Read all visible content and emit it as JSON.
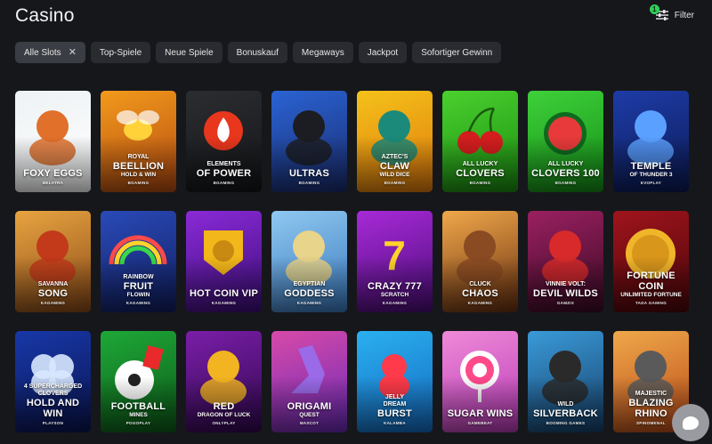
{
  "page": {
    "title": "Casino"
  },
  "filter": {
    "label": "Filter",
    "count": "1"
  },
  "chips": [
    {
      "label": "Alle Slots",
      "active": true
    },
    {
      "label": "Top-Spiele"
    },
    {
      "label": "Neue Spiele"
    },
    {
      "label": "Bonuskauf"
    },
    {
      "label": "Megaways"
    },
    {
      "label": "Jackpot"
    },
    {
      "label": "Sofortiger Gewinn"
    }
  ],
  "games": [
    {
      "pre": "",
      "title": "Foxy Eggs",
      "sub": "",
      "provider": "Belatra",
      "bg": [
        "#eef2f4",
        "#ffffff"
      ],
      "accent": "#e0702a",
      "icon": "fox-icon"
    },
    {
      "pre": "Royal",
      "title": "Beellion",
      "sub": "Hold & Win",
      "provider": "BGaming",
      "bg": [
        "#f29a1c",
        "#b54a10"
      ],
      "accent": "#ffd23a",
      "icon": "bee-icon"
    },
    {
      "pre": "Elements",
      "title": "of Power",
      "sub": "",
      "provider": "BGaming",
      "bg": [
        "#2b2d31",
        "#141517"
      ],
      "accent": "#e8371d",
      "icon": "fire-icon"
    },
    {
      "pre": "",
      "title": "Ultras",
      "sub": "",
      "provider": "BGaming",
      "bg": [
        "#2a63d4",
        "#1a2c6e"
      ],
      "accent": "#1c1d22",
      "icon": "fan-icon"
    },
    {
      "pre": "Aztec's",
      "title": "Claw",
      "sub": "Wild Dice",
      "provider": "BGaming",
      "bg": [
        "#f4c21a",
        "#e07a0c"
      ],
      "accent": "#1b8a7a",
      "icon": "aztec-icon"
    },
    {
      "pre": "All Lucky",
      "title": "Clovers",
      "sub": "",
      "provider": "BGaming",
      "bg": [
        "#4ad12e",
        "#1a8c10"
      ],
      "accent": "#d41e1e",
      "icon": "cherry-icon"
    },
    {
      "pre": "All Lucky",
      "title": "Clovers 100",
      "sub": "",
      "provider": "BGaming",
      "bg": [
        "#3fd13a",
        "#138c16"
      ],
      "accent": "#0e6a1e",
      "icon": "watermelon-icon"
    },
    {
      "pre": "",
      "title": "Temple",
      "sub": "of Thunder 3",
      "provider": "Evoplay",
      "bg": [
        "#1e3ca8",
        "#0b1a54"
      ],
      "accent": "#5aa0ff",
      "icon": "zeus-icon"
    },
    {
      "pre": "Savanna",
      "title": "Song",
      "sub": "",
      "provider": "Kagaming",
      "bg": [
        "#e8a440",
        "#8a4a18"
      ],
      "accent": "#c23a1a",
      "icon": "mask-icon"
    },
    {
      "pre": "Rainbow",
      "title": "Fruit",
      "sub": "Flowin",
      "provider": "Kagaming",
      "bg": [
        "#2a4ab8",
        "#101e60"
      ],
      "accent": "#ff5a6a",
      "icon": "rainbow-icon"
    },
    {
      "pre": "",
      "title": "Hot Coin VIP",
      "sub": "",
      "provider": "Kagaming",
      "bg": [
        "#8a2ad8",
        "#3c0e78"
      ],
      "accent": "#f2b71a",
      "icon": "coin-icon"
    },
    {
      "pre": "Egyptian",
      "title": "Goddess",
      "sub": "",
      "provider": "Kagaming",
      "bg": [
        "#8fc8f0",
        "#3a7ac0"
      ],
      "accent": "#e8d48a",
      "icon": "goddess-icon"
    },
    {
      "pre": "",
      "title": "Crazy 777",
      "sub": "Scratch",
      "provider": "Kagaming",
      "bg": [
        "#a82ad8",
        "#4a0c78"
      ],
      "accent": "#ffd42a",
      "icon": "seven-icon"
    },
    {
      "pre": "Cluck",
      "title": "Chaos",
      "sub": "",
      "provider": "Kagaming",
      "bg": [
        "#f0a84a",
        "#6a3010"
      ],
      "accent": "#8a4a22",
      "icon": "turkey-icon"
    },
    {
      "pre": "Vinnie Volt:",
      "title": "Devil Wilds",
      "sub": "",
      "provider": "Gamzix",
      "bg": [
        "#9a2060",
        "#3a0a24"
      ],
      "accent": "#d82a2a",
      "icon": "devil-icon"
    },
    {
      "pre": "",
      "title": "Fortune Coin",
      "sub": "Unlimited Fortune",
      "provider": "TaDa Gaming",
      "bg": [
        "#a0141c",
        "#4a060a"
      ],
      "accent": "#f0b62a",
      "icon": "gold-coin-icon"
    },
    {
      "pre": "4 Supercharged",
      "title": "Hold and Win",
      "sub": "",
      "pre2": "Clovers",
      "provider": "Playson",
      "bg": [
        "#1838a8",
        "#0a1450"
      ],
      "accent": "#d8e8ff",
      "icon": "diamond-clover-icon"
    },
    {
      "pre": "",
      "title": "Football",
      "sub": "Mines",
      "provider": "Pogoplay",
      "bg": [
        "#1ea838",
        "#0c5a18"
      ],
      "accent": "#e82a2a",
      "icon": "football-icon"
    },
    {
      "pre": "",
      "title": "Red",
      "sub": "Dragon of Luck",
      "provider": "Onlyplay",
      "bg": [
        "#7a1ea8",
        "#30084e"
      ],
      "accent": "#f2b420",
      "icon": "dragon-icon"
    },
    {
      "pre": "",
      "title": "Origami",
      "sub": "Quest",
      "provider": "Mascot",
      "bg": [
        "#d84aa8",
        "#6a2ab8"
      ],
      "accent": "#9a6ae8",
      "icon": "origami-rabbit-icon"
    },
    {
      "pre": "Jelly",
      "title": "Burst",
      "sub": "",
      "pre2": "Dream",
      "provider": "Kalamba",
      "bg": [
        "#2ab0f0",
        "#146ac0"
      ],
      "accent": "#ff3a4a",
      "icon": "gummy-bear-icon"
    },
    {
      "pre": "",
      "title": "Sugar Wins",
      "sub": "",
      "provider": "Gamebeat",
      "bg": [
        "#f08ad8",
        "#b83ab8"
      ],
      "accent": "#ff4a8a",
      "icon": "lollipop-icon"
    },
    {
      "pre": "Wild",
      "title": "Silverback",
      "sub": "",
      "provider": "Booming Games",
      "bg": [
        "#3a9ad8",
        "#16406a"
      ],
      "accent": "#2a2a2a",
      "icon": "gorilla-icon"
    },
    {
      "pre": "Majestic",
      "title": "Blazing Rhino",
      "sub": "",
      "provider": "Spinomenal",
      "bg": [
        "#f0a84a",
        "#b84a18"
      ],
      "accent": "#5a5a5a",
      "icon": "rhino-icon"
    }
  ]
}
